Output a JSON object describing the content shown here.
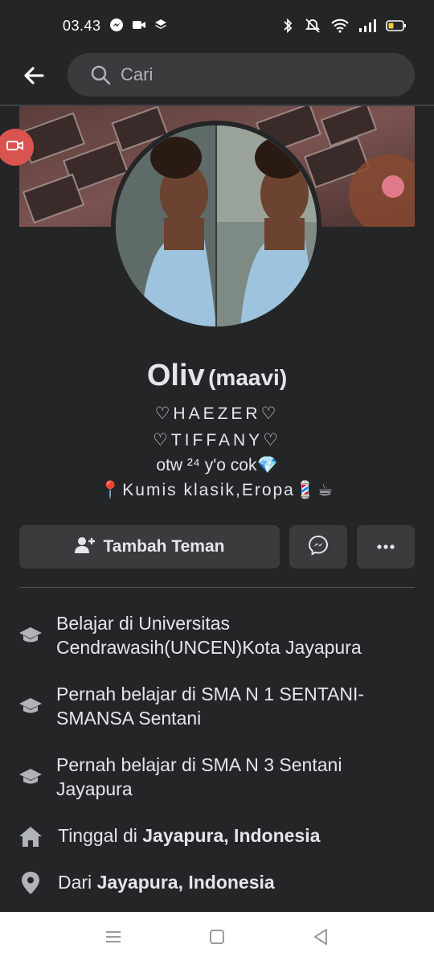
{
  "status_bar": {
    "time": "03.43",
    "icons_left": [
      "messenger-icon",
      "video-icon",
      "layers-icon"
    ],
    "icons_right": [
      "bluetooth-icon",
      "mute-icon",
      "wifi-icon",
      "signal-icon",
      "battery-icon"
    ]
  },
  "header": {
    "back_icon": "arrow-left-icon",
    "search_placeholder": "Cari",
    "search_icon": "search-icon"
  },
  "profile": {
    "name": "Oliv",
    "alt_name": "(maavi)",
    "bio": [
      "♡HAEZER♡",
      "♡TIFFANY♡",
      "otw ²⁴ y'o cok💎",
      "📍Kumis klasik,Eropa💈☕"
    ]
  },
  "actions": {
    "add_friend_label": "Tambah Teman",
    "add_friend_icon": "add-friend-icon",
    "message_icon": "messenger-icon",
    "more_icon": "more-icon"
  },
  "about": {
    "items": [
      {
        "icon": "education-icon",
        "prefix": "Belajar di Universitas Cendrawasih(UNCEN)Kota Jayapura",
        "bold": ""
      },
      {
        "icon": "education-icon",
        "prefix": "Pernah belajar di SMA N 1 SENTANI-SMANSA Sentani",
        "bold": ""
      },
      {
        "icon": "education-icon",
        "prefix": "Pernah belajar di SMA N 3 Sentani Jayapura",
        "bold": ""
      },
      {
        "icon": "home-icon",
        "prefix": "Tinggal di ",
        "bold": "Jayapura, Indonesia"
      },
      {
        "icon": "location-pin-icon",
        "prefix": "Dari ",
        "bold": "Jayapura, Indonesia"
      }
    ]
  },
  "nav_bar": {
    "icons": [
      "menu-icon",
      "home-square-icon",
      "back-triangle-icon"
    ]
  },
  "colors": {
    "background": "#242526",
    "surface": "#3a3b3c",
    "text": "#e4e6eb",
    "muted": "#b0b3b8",
    "badge": "#d9534f"
  }
}
